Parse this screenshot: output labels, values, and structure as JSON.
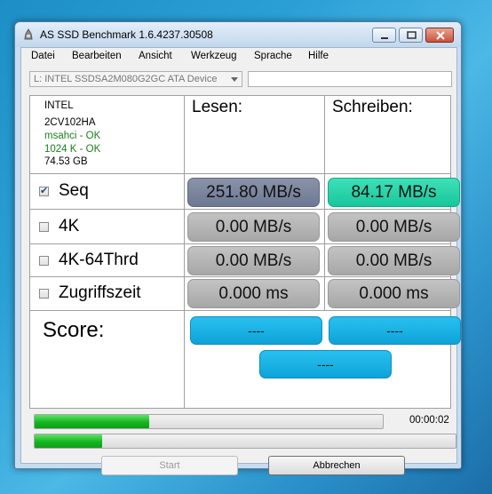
{
  "window": {
    "title": "AS SSD Benchmark 1.6.4237.30508"
  },
  "menu": [
    "Datei",
    "Bearbeiten",
    "Ansicht",
    "Werkzeug",
    "Sprache",
    "Hilfe"
  ],
  "device_select": {
    "value": "L: INTEL SSDSA2M080G2GC ATA Device"
  },
  "device_info": {
    "vendor": "INTEL",
    "firmware": "2CV102HA",
    "driver_status": "msahci - OK",
    "alignment_status": "1024 K - OK",
    "capacity": "74.53 GB"
  },
  "headers": {
    "read": "Lesen:",
    "write": "Schreiben:"
  },
  "tests": [
    {
      "label": "Seq",
      "checked": true,
      "read": "251.80 MB/s",
      "write": "84.17 MB/s"
    },
    {
      "label": "4K",
      "checked": false,
      "read": "0.00 MB/s",
      "write": "0.00 MB/s"
    },
    {
      "label": "4K-64Thrd",
      "checked": false,
      "read": "0.00 MB/s",
      "write": "0.00 MB/s"
    },
    {
      "label": "Zugriffszeit",
      "checked": false,
      "read": "0.000 ms",
      "write": "0.000 ms"
    }
  ],
  "score": {
    "label": "Score:",
    "read": "----",
    "write": "----",
    "total": "----"
  },
  "progress": {
    "current_test": 0.33,
    "overall": 0.16,
    "elapsed": "00:00:02"
  },
  "buttons": {
    "start": "Start",
    "cancel": "Abbrechen"
  },
  "colors": {
    "seq_read": "#7a839c",
    "seq_write": "#25d6ab",
    "score": "#16b0e4",
    "progress": "#17b822"
  }
}
